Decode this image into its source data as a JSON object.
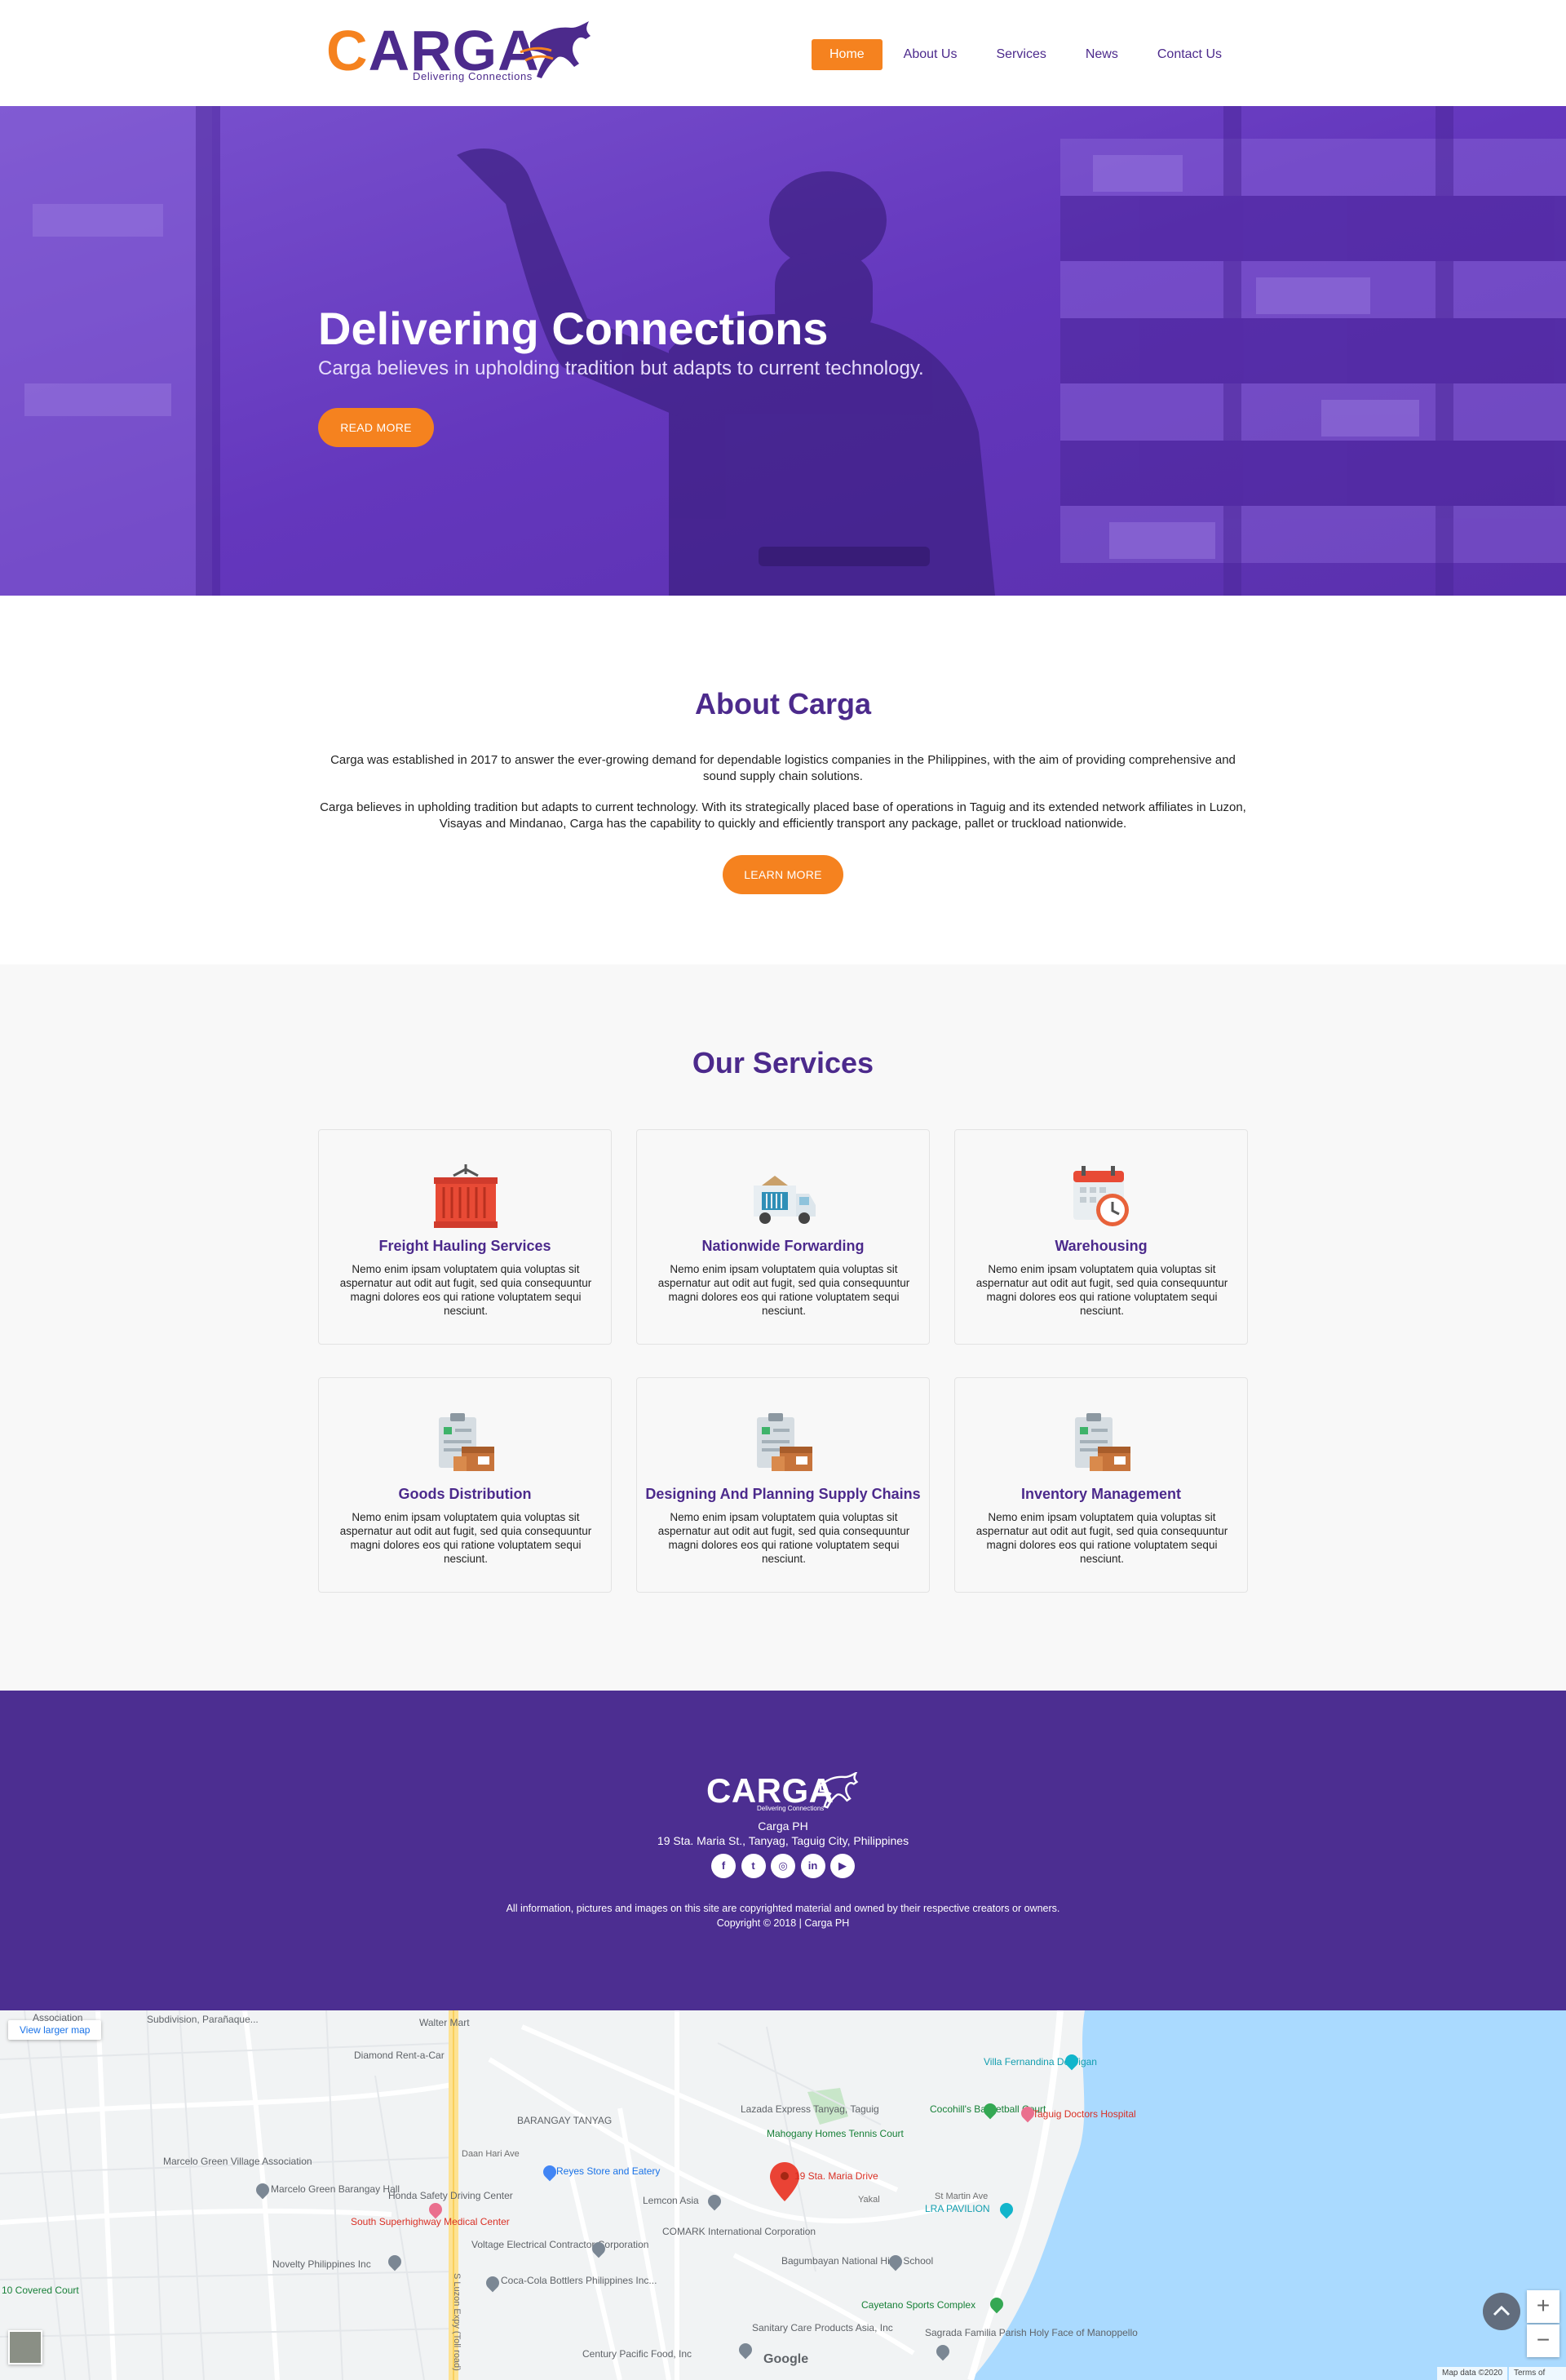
{
  "header": {
    "logo_brand": "CARGA",
    "logo_tagline": "Delivering Connections",
    "nav": [
      "Home",
      "About Us",
      "Services",
      "News",
      "Contact Us"
    ],
    "active_nav": "Home"
  },
  "hero": {
    "title": "Delivering Connections",
    "subtitle": "Carga believes in upholding tradition but adapts to current technology.",
    "button": "READ MORE",
    "overlay_color": "#6a3fc2"
  },
  "about": {
    "title": "About Carga",
    "p1": "Carga was established in 2017 to answer the ever-growing demand for dependable logistics companies in the Philippines, with the aim of providing comprehensive and sound supply chain solutions.",
    "p2": "Carga believes in upholding tradition but adapts to current technology. With its strategically placed base of operations in Taguig and its extended network affiliates in Luzon, Visayas and Mindanao, Carga has the capability to quickly and efficiently transport any package, pallet or truckload nationwide.",
    "button": "LEARN MORE"
  },
  "services": {
    "title": "Our Services",
    "items": [
      {
        "title": "Freight Hauling Services",
        "icon": "container-icon",
        "text": "Nemo enim ipsam voluptatem quia voluptas sit aspernatur aut odit aut fugit, sed quia consequuntur magni dolores eos qui ratione voluptatem sequi nesciunt."
      },
      {
        "title": "Nationwide Forwarding",
        "icon": "truck-icon",
        "text": "Nemo enim ipsam voluptatem quia voluptas sit aspernatur aut odit aut fugit, sed quia consequuntur magni dolores eos qui ratione voluptatem sequi nesciunt."
      },
      {
        "title": "Warehousing",
        "icon": "calendar-clock-icon",
        "text": "Nemo enim ipsam voluptatem quia voluptas sit aspernatur aut odit aut fugit, sed quia consequuntur magni dolores eos qui ratione voluptatem sequi nesciunt."
      },
      {
        "title": "Goods Distribution",
        "icon": "clipboard-boxes-icon",
        "text": "Nemo enim ipsam voluptatem quia voluptas sit aspernatur aut odit aut fugit, sed quia consequuntur magni dolores eos qui ratione voluptatem sequi nesciunt."
      },
      {
        "title": "Designing And Planning Supply Chains",
        "icon": "clipboard-boxes-icon",
        "text": "Nemo enim ipsam voluptatem quia voluptas sit aspernatur aut odit aut fugit, sed quia consequuntur magni dolores eos qui ratione voluptatem sequi nesciunt."
      },
      {
        "title": "Inventory Management",
        "icon": "clipboard-boxes-icon",
        "text": "Nemo enim ipsam voluptatem quia voluptas sit aspernatur aut odit aut fugit, sed quia consequuntur magni dolores eos qui ratione voluptatem sequi nesciunt."
      }
    ]
  },
  "footer": {
    "logo_brand": "CARGA",
    "logo_tagline": "Delivering Connections",
    "company": "Carga PH",
    "address": "19 Sta. Maria St., Tanyag, Taguig City, Philippines",
    "socials": [
      "facebook-icon",
      "twitter-icon",
      "instagram-icon",
      "linkedin-icon",
      "youtube-icon"
    ],
    "social_glyphs": [
      "f",
      "t",
      "◎",
      "in",
      "▶"
    ],
    "note": "All information, pictures and images on this site are copyrighted material and owned by their respective creators or owners.",
    "copyright": "Copyright © 2018 | Carga PH",
    "background": "#4c2e91"
  },
  "map": {
    "view_larger": "View larger map",
    "marker_label": "19 Sta. Maria Drive",
    "zoom_in": "+",
    "zoom_out": "−",
    "google": "Google",
    "map_data": "Map data ©2020",
    "terms": "Terms of Use",
    "labels": {
      "subdivision": "Subdivision, Parañaque...",
      "association": "Association",
      "walter_mart": "Walter Mart",
      "diamond": "Diamond Rent-a-Car",
      "barangay_tanyag": "BARANGAY TANYAG",
      "lazada": "Lazada Express Tanyag, Taguig",
      "mahogany": "Mahogany Homes Tennis Court",
      "villa": "Villa Fernandina De Vigan",
      "cocohills": "Cocohill's Basketball Court",
      "taguig_doctors": "Taguig Doctors Hospital",
      "lra": "LRA PAVILION",
      "reyes": "Reyes Store and Eatery",
      "lemcon": "Lemcon Asia",
      "comark": "COMARK International Corporation",
      "bagumbayan": "Bagumbayan National High School",
      "cayetano": "Cayetano Sports Complex",
      "sagrada": "Sagrada Familia Parish Holy Face of Manoppello",
      "sanitary": "Sanitary Care Products Asia, Inc",
      "century": "Century Pacific Food, Inc",
      "cocacola": "Coca-Cola Bottlers Philippines Inc...",
      "voltage": "Voltage Electrical Contractor Corporation",
      "novelty": "Novelty Philippines Inc",
      "south_hospital": "South Superhighway Medical Center",
      "honda": "Honda Safety Driving Center",
      "marcelo_hall": "Marcelo Green Barangay Hall",
      "marcelo_assoc": "Marcelo Green Village Association",
      "covered_court": "10 Covered Court",
      "slex": "S Luzon Expy (Toll road)",
      "yakal": "Yakal",
      "daan_hari": "Daan Hari Ave",
      "st_martin": "St Martin Ave"
    }
  }
}
